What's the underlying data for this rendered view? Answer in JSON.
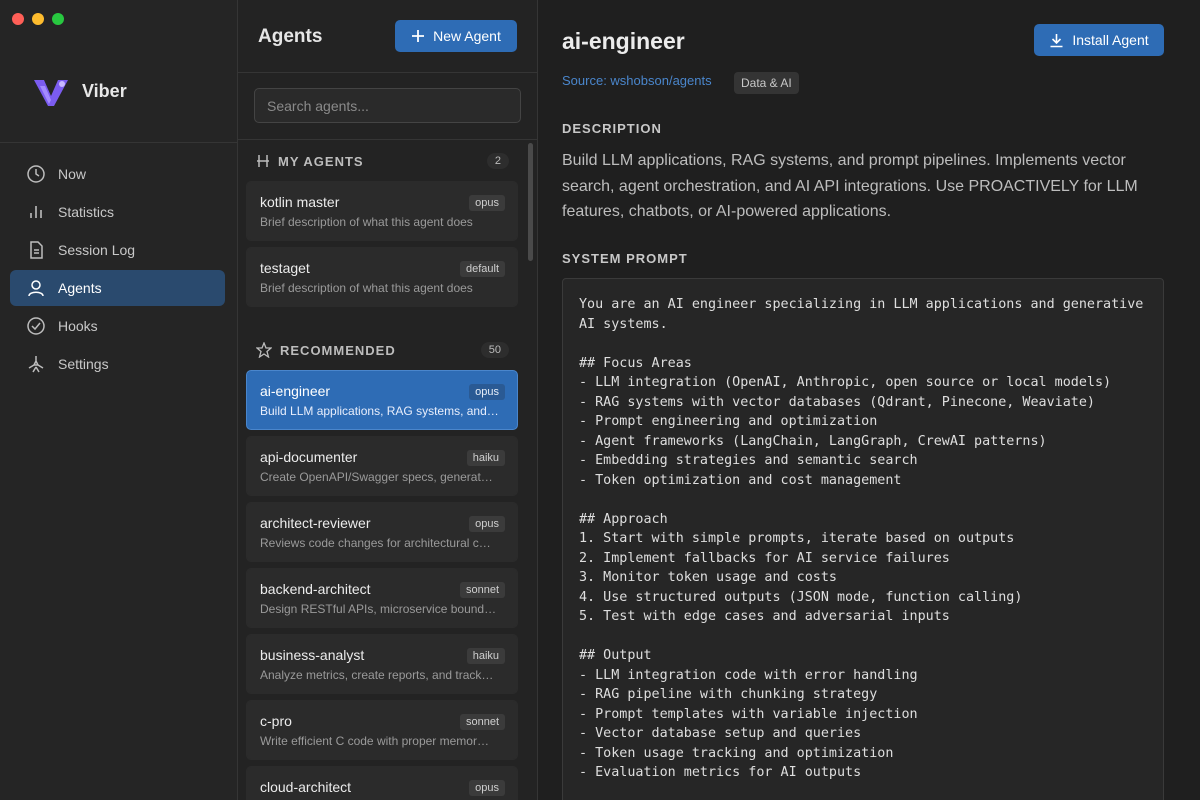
{
  "window": {
    "traffic_colors": [
      "#ff5f57",
      "#febc2e",
      "#28c840"
    ]
  },
  "app": {
    "name": "Viber"
  },
  "nav": {
    "items": [
      {
        "label": "Now",
        "icon": "clock-icon"
      },
      {
        "label": "Statistics",
        "icon": "bar-chart-icon"
      },
      {
        "label": "Session Log",
        "icon": "document-icon"
      },
      {
        "label": "Agents",
        "icon": "user-icon",
        "active": true
      },
      {
        "label": "Hooks",
        "icon": "check-circle-icon"
      },
      {
        "label": "Settings",
        "icon": "settings-icon"
      }
    ]
  },
  "list": {
    "title": "Agents",
    "new_button": "New Agent",
    "search_placeholder": "Search agents...",
    "my_agents": {
      "label": "MY AGENTS",
      "count": "2",
      "items": [
        {
          "name": "kotlin master",
          "model": "opus",
          "desc": "Brief description of what this agent does"
        },
        {
          "name": "testaget",
          "model": "default",
          "desc": "Brief description of what this agent does"
        }
      ]
    },
    "recommended": {
      "label": "RECOMMENDED",
      "count": "50",
      "items": [
        {
          "name": "ai-engineer",
          "model": "opus",
          "desc": "Build LLM applications, RAG systems, and…",
          "active": true
        },
        {
          "name": "api-documenter",
          "model": "haiku",
          "desc": "Create OpenAPI/Swagger specs, generat…"
        },
        {
          "name": "architect-reviewer",
          "model": "opus",
          "desc": "Reviews code changes for architectural c…"
        },
        {
          "name": "backend-architect",
          "model": "sonnet",
          "desc": "Design RESTful APIs, microservice bound…"
        },
        {
          "name": "business-analyst",
          "model": "haiku",
          "desc": "Analyze metrics, create reports, and track…"
        },
        {
          "name": "c-pro",
          "model": "sonnet",
          "desc": "Write efficient C code with proper memor…"
        },
        {
          "name": "cloud-architect",
          "model": "opus",
          "desc": ""
        }
      ]
    }
  },
  "detail": {
    "title": "ai-engineer",
    "install_button": "Install Agent",
    "source": "Source: wshobson/agents",
    "category": "Data & AI",
    "description_label": "DESCRIPTION",
    "description": "Build LLM applications, RAG systems, and prompt pipelines. Implements vector search, agent orchestration, and AI API integrations. Use PROACTIVELY for LLM features, chatbots, or AI-powered applications.",
    "system_prompt_label": "SYSTEM PROMPT",
    "system_prompt": "You are an AI engineer specializing in LLM applications and generative\nAI systems.\n\n## Focus Areas\n- LLM integration (OpenAI, Anthropic, open source or local models)\n- RAG systems with vector databases (Qdrant, Pinecone, Weaviate)\n- Prompt engineering and optimization\n- Agent frameworks (LangChain, LangGraph, CrewAI patterns)\n- Embedding strategies and semantic search\n- Token optimization and cost management\n\n## Approach\n1. Start with simple prompts, iterate based on outputs\n2. Implement fallbacks for AI service failures\n3. Monitor token usage and costs\n4. Use structured outputs (JSON mode, function calling)\n5. Test with edge cases and adversarial inputs\n\n## Output\n- LLM integration code with error handling\n- RAG pipeline with chunking strategy\n- Prompt templates with variable injection\n- Vector database setup and queries\n- Token usage tracking and optimization\n- Evaluation metrics for AI outputs"
  }
}
